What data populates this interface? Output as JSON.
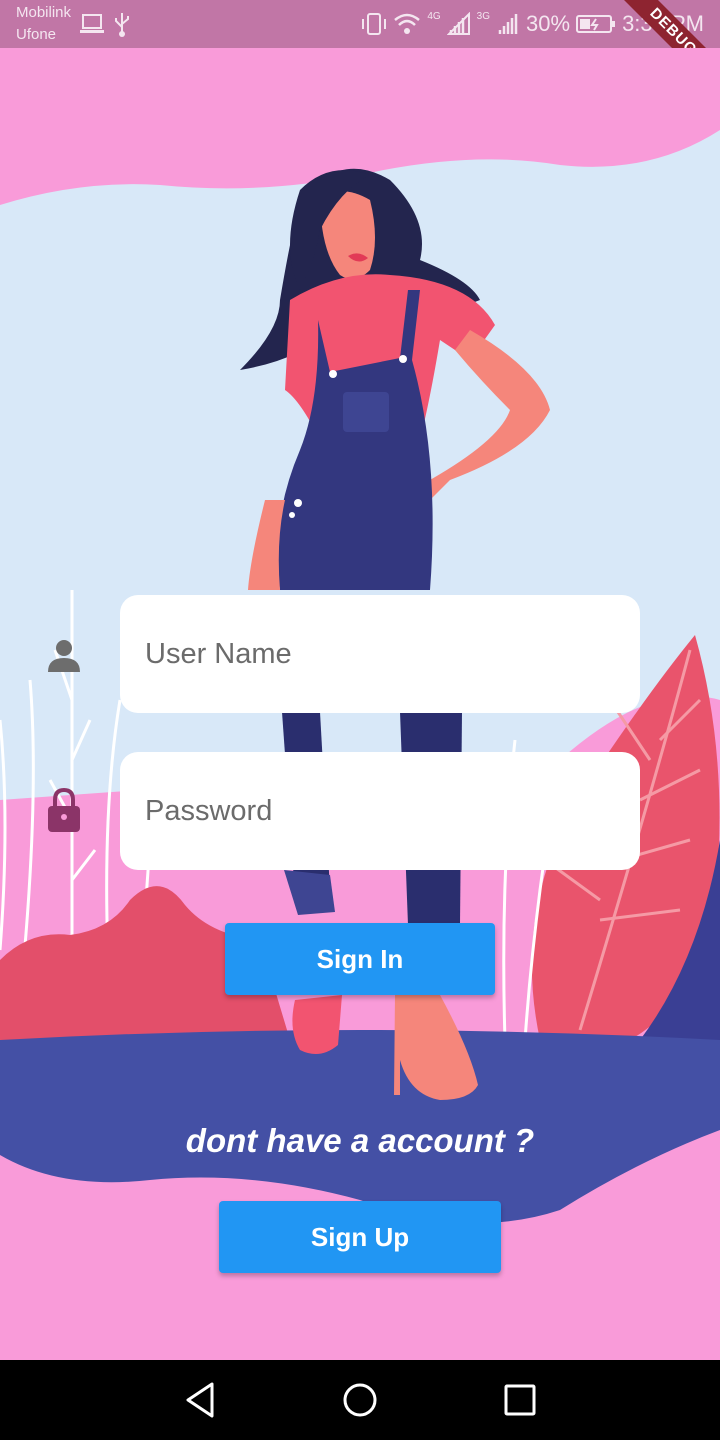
{
  "status_bar": {
    "carrier_primary": "Mobilink",
    "carrier_secondary": "Ufone",
    "network_1": "4G",
    "network_2": "3G",
    "battery": "30%",
    "time": "3:35 PM"
  },
  "debug_banner": "DEBUG",
  "login": {
    "username_placeholder": "User Name",
    "password_placeholder": "Password",
    "sign_in_label": "Sign In",
    "no_account_text": "dont have a account ?",
    "sign_up_label": "Sign Up"
  },
  "icons": {
    "user": "person-icon",
    "password": "lock-icon",
    "back": "back-triangle-icon",
    "home": "home-circle-icon",
    "recent": "recent-square-icon"
  },
  "colors": {
    "background": "#f99bd9",
    "sky": "#d8e8f8",
    "button": "#2196f3",
    "ground": "#4450a5",
    "leaf": "#e9546c"
  }
}
